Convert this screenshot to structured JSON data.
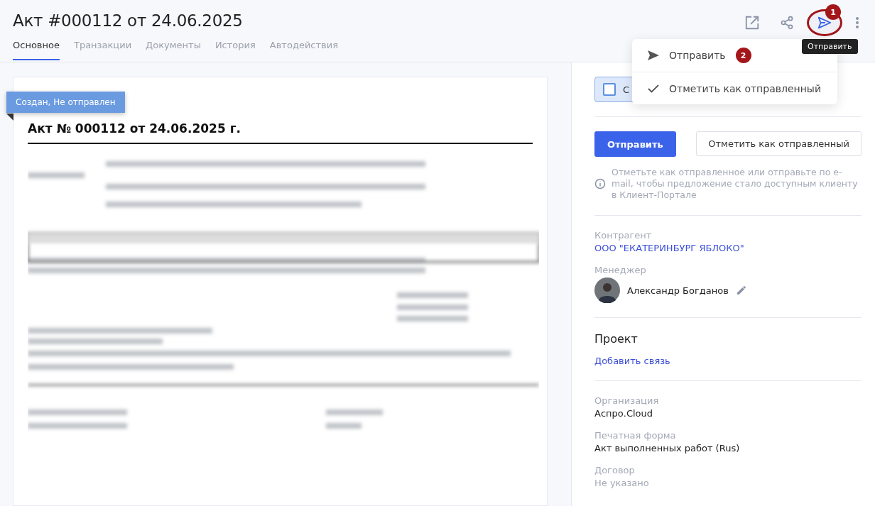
{
  "title": "Акт #000112 от 24.06.2025",
  "tabs": [
    {
      "label": "Основное",
      "selected": true
    },
    {
      "label": "Транзакции",
      "selected": false
    },
    {
      "label": "Документы",
      "selected": false
    },
    {
      "label": "История",
      "selected": false
    },
    {
      "label": "Автодействия",
      "selected": false
    }
  ],
  "toolbar": {
    "send_marker": "1",
    "tooltip": "Отправить"
  },
  "menu": {
    "items": [
      {
        "kind": "send",
        "label": "Отправить",
        "marker": "2"
      },
      {
        "kind": "check",
        "label": "Отметить как отправленный"
      }
    ]
  },
  "document": {
    "status": "Создан, Не отправлен",
    "heading": "Акт № 000112 от 24.06.2025 г."
  },
  "sidebar": {
    "checkbox": {
      "label": "С",
      "checked": false
    },
    "primary_button": "Отправить",
    "secondary_button": "Отметить как отправленный",
    "hint": "Отметьте как отправленное или отправьте по e-mail, чтобы предложение стало доступным клиенту в Клиент-Портале",
    "counterparty": {
      "label": "Контрагент",
      "value": "ООО \"ЕКАТЕРИНБУРГ ЯБЛОКО\""
    },
    "manager": {
      "label": "Менеджер",
      "name": "Александр Богданов"
    },
    "project": {
      "title": "Проект",
      "link": "Добавить связь"
    },
    "fields": [
      {
        "label": "Организация",
        "value": "Аспро.Cloud",
        "muted": false
      },
      {
        "label": "Печатная форма",
        "value": "Акт выполненных работ (Rus)",
        "muted": false
      },
      {
        "label": "Договор",
        "value": "Не указано",
        "muted": true
      }
    ]
  }
}
